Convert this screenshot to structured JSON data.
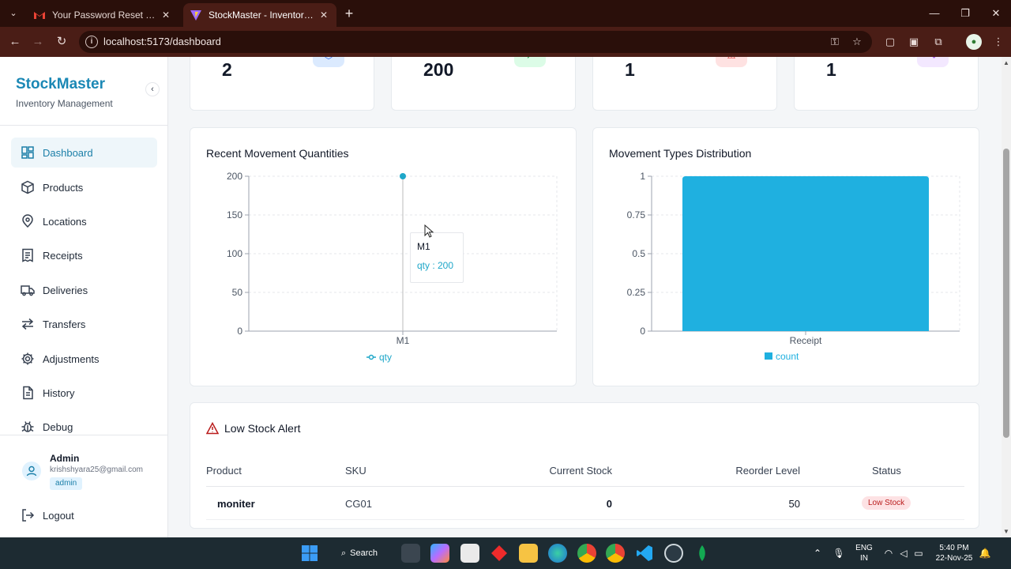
{
  "browser": {
    "tabs": [
      {
        "title": "Your Password Reset OTP - krish",
        "active": false
      },
      {
        "title": "StockMaster - Inventory Manag",
        "active": true
      }
    ],
    "url": "localhost:5173/dashboard"
  },
  "sidebar": {
    "brand": "StockMaster",
    "subtitle": "Inventory Management",
    "items": [
      {
        "label": "Dashboard",
        "icon": "dashboard-icon",
        "active": true
      },
      {
        "label": "Products",
        "icon": "box-icon"
      },
      {
        "label": "Locations",
        "icon": "map-pin-icon"
      },
      {
        "label": "Receipts",
        "icon": "receipt-icon"
      },
      {
        "label": "Deliveries",
        "icon": "truck-icon"
      },
      {
        "label": "Transfers",
        "icon": "transfer-arrows-icon"
      },
      {
        "label": "Adjustments",
        "icon": "gear-icon"
      },
      {
        "label": "History",
        "icon": "document-icon"
      },
      {
        "label": "Debug",
        "icon": "bug-icon"
      }
    ],
    "user": {
      "name": "Admin",
      "email": "krishshyara25@gmail.com",
      "role": "admin"
    },
    "logout": "Logout"
  },
  "stats": [
    {
      "value": "2",
      "icon": "cube-icon",
      "color": "#dbeafe"
    },
    {
      "value": "200",
      "icon": "trend-up-icon",
      "color": "#dcfce7"
    },
    {
      "value": "1",
      "icon": "alert-triangle-icon",
      "color": "#fee2e2"
    },
    {
      "value": "1",
      "icon": "activity-icon",
      "color": "#f3e8ff"
    }
  ],
  "movement_chart": {
    "title": "Recent Movement Quantities",
    "tooltip": {
      "label": "M1",
      "value": "qty : 200"
    }
  },
  "types_chart": {
    "title": "Movement Types Distribution"
  },
  "chart_data": [
    {
      "type": "line",
      "title": "Recent Movement Quantities",
      "x": [
        "M1"
      ],
      "series": [
        {
          "name": "qty",
          "values": [
            200
          ]
        }
      ],
      "yticks": [
        "0",
        "50",
        "100",
        "150",
        "200"
      ],
      "ylim": [
        0,
        200
      ],
      "grid": true,
      "legend": "bottom",
      "color": "#1fa7c9"
    },
    {
      "type": "bar",
      "title": "Movement Types Distribution",
      "categories": [
        "Receipt"
      ],
      "series": [
        {
          "name": "count",
          "values": [
            1
          ]
        }
      ],
      "yticks": [
        "0",
        "0.25",
        "0.5",
        "0.75",
        "1"
      ],
      "ylim": [
        0,
        1
      ],
      "grid": true,
      "legend": "bottom",
      "color": "#1fb0e0"
    }
  ],
  "low_stock": {
    "title": "Low Stock Alert",
    "columns": [
      "Product",
      "SKU",
      "Current Stock",
      "Reorder Level",
      "Status"
    ],
    "rows": [
      {
        "product": "moniter",
        "sku": "CG01",
        "current": "0",
        "reorder": "50",
        "status": "Low Stock"
      }
    ]
  },
  "taskbar": {
    "search": "Search",
    "lang": "ENG",
    "region": "IN",
    "time": "5:40 PM",
    "date": "22-Nov-25"
  }
}
